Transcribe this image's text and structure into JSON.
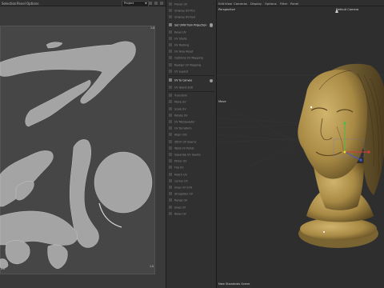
{
  "uv_editor": {
    "menu": [
      "Selection",
      "Panel",
      "Options"
    ],
    "dropdown_value": "Project",
    "ticks": {
      "top_right": "1.0",
      "bottom_left": "0.0",
      "bottom_right": "1.0"
    }
  },
  "palette": {
    "items": [
      {
        "label": "Planar UV",
        "bright": false
      },
      {
        "label": "Unwrap UV Pins",
        "bright": false
      },
      {
        "label": "Unwrap UV Fast",
        "bright": false
      },
      {
        "label": "Set UVW from Projection",
        "bright": true
      },
      {
        "label": "Relax UV",
        "bright": false
      },
      {
        "label": "UV Shells",
        "bright": false
      },
      {
        "label": "UV Packing",
        "bright": false
      },
      {
        "label": "UV Area Reset",
        "bright": false
      },
      {
        "label": "Optimize UV Mapping",
        "bright": false
      },
      {
        "label": "Realign UV Mapping",
        "bright": false
      },
      {
        "label": "UV Layout",
        "bright": false
      },
      {
        "label": "UV to Canvas",
        "bright": true
      },
      {
        "label": "UV Island Edit",
        "bright": false
      },
      {
        "label": "Transform",
        "bright": false
      },
      {
        "label": "Move UV",
        "bright": false
      },
      {
        "label": "Scale UV",
        "bright": false
      },
      {
        "label": "Rotate UV",
        "bright": false
      },
      {
        "label": "UV Manipulator",
        "bright": false
      },
      {
        "label": "UV Terraform",
        "bright": false
      },
      {
        "label": "Align UVs",
        "bright": false
      },
      {
        "label": "Stitch UV Seams",
        "bright": false
      },
      {
        "label": "Weld UV Points",
        "bright": false
      },
      {
        "label": "Separate UV Seams",
        "bright": false
      },
      {
        "label": "Mirror UV",
        "bright": false
      },
      {
        "label": "Flip UV",
        "bright": false
      },
      {
        "label": "Match UV",
        "bright": false
      },
      {
        "label": "Center UV",
        "bright": false
      },
      {
        "label": "Snap UV Grid",
        "bright": false
      },
      {
        "label": "Straighten UV",
        "bright": false
      },
      {
        "label": "Range UV",
        "bright": false
      },
      {
        "label": "Snap UV",
        "bright": false
      },
      {
        "label": "Relax UV",
        "bright": false
      }
    ]
  },
  "viewport": {
    "menu": [
      "Edit",
      "View",
      "Cameras",
      "Display",
      "Options",
      "Filter",
      "Panel"
    ],
    "view_name": "Perspective",
    "camera_name": "Default Camera",
    "tool_name": "Move",
    "status": "New Standards Scene"
  },
  "colors": {
    "uv_shell": "#a9a9a9",
    "bust": "#b59a54",
    "axis_x": "#d23b3b",
    "axis_y": "#43c043",
    "axis_z": "#3d56d6"
  }
}
